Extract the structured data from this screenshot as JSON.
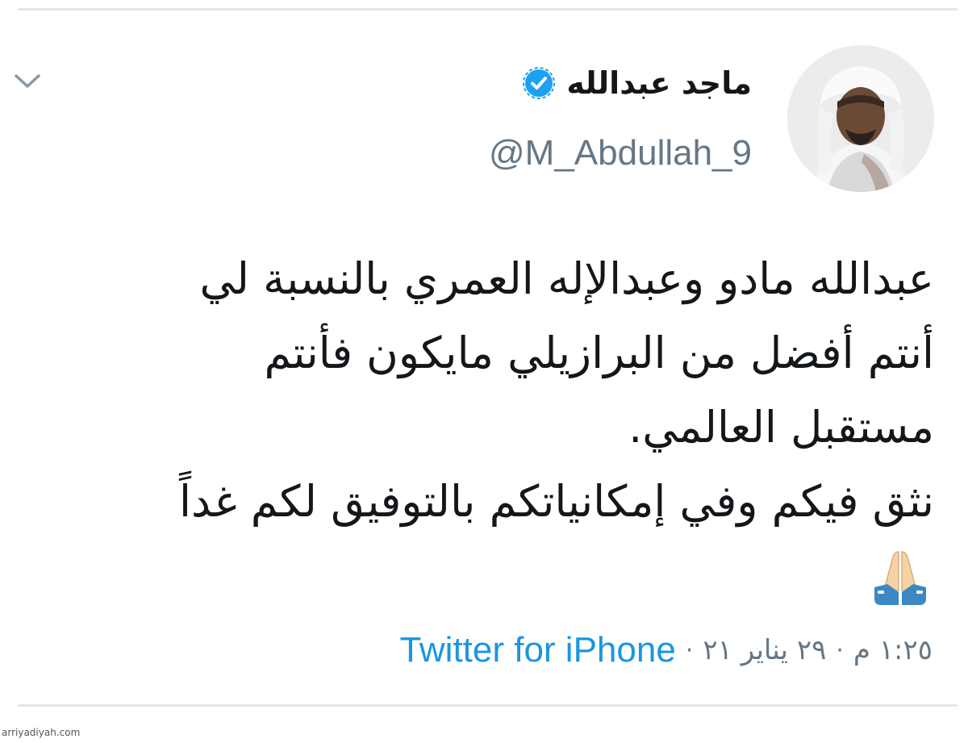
{
  "tweet": {
    "author": {
      "display_name": "ماجد عبدالله",
      "handle": "@M_Abdullah_9",
      "verified": true,
      "verified_badge_icon": "verified-badge-icon",
      "avatar_icon": "profile-photo"
    },
    "menu_icon": "chevron-down-icon",
    "text_lines": [
      "عبدالله مادو وعبدالإله العمري بالنسبة لي",
      "أنتم أفضل من البرازيلي مايكون فأنتم",
      "مستقبل العالمي.",
      "نثق فيكم وفي إمكانياتكم بالتوفيق لكم غداً"
    ],
    "emoji_icon": "folded-hands-emoji",
    "meta": {
      "time": "١:٢٥ م",
      "date": "٢٩ يناير ٢١",
      "source": "Twitter for iPhone",
      "separator": "·"
    }
  },
  "watermark": "arriyadiyah.com",
  "colors": {
    "text_primary": "#14171a",
    "text_secondary": "#657786",
    "link_blue": "#1b95e0",
    "verified_blue": "#1da1f2",
    "divider": "#e1e6ea"
  }
}
